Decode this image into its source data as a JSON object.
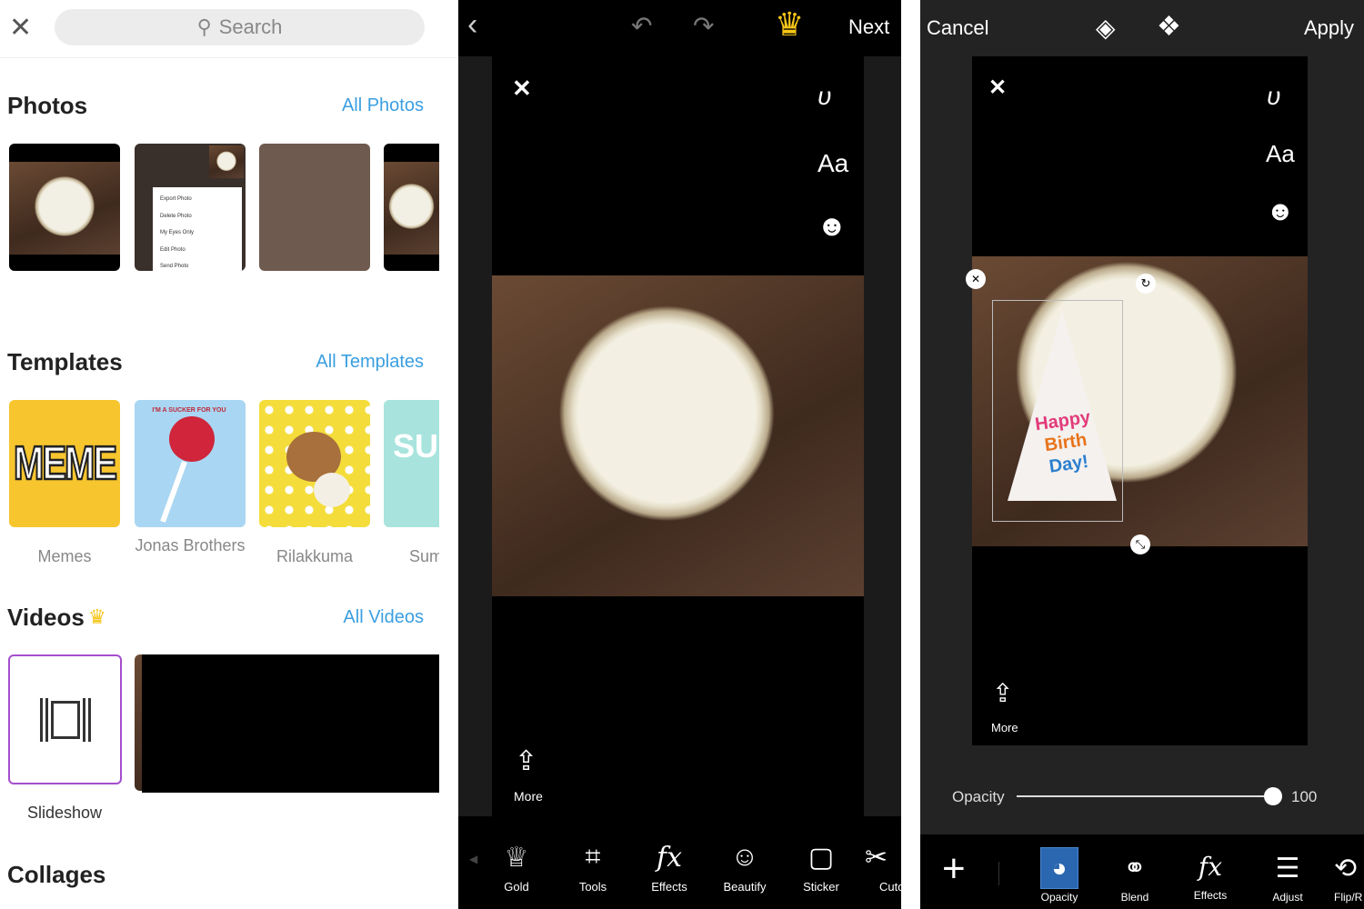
{
  "left": {
    "search_placeholder": "Search",
    "photos": {
      "title": "Photos",
      "link": "All Photos",
      "menu": [
        "Export Photo",
        "Delete Photo",
        "My Eyes Only",
        "Edit Photo",
        "Send Photo"
      ]
    },
    "templates": {
      "title": "Templates",
      "link": "All Templates",
      "items": [
        {
          "label": "Memes",
          "art": "MEME"
        },
        {
          "label": "Jonas Brothers",
          "art": "I'M A SUCKER FOR YOU"
        },
        {
          "label": "Rilakkuma"
        },
        {
          "label": "Sum",
          "art": "SUM"
        }
      ]
    },
    "videos": {
      "title": "Videos",
      "link": "All Videos",
      "slideshow": "Slideshow"
    },
    "collages": {
      "title": "Collages"
    }
  },
  "mid": {
    "next": "Next",
    "text_tool": "Aa",
    "more": "More",
    "tools": [
      "Gold",
      "Tools",
      "Effects",
      "Beautify",
      "Sticker",
      "Cuto"
    ],
    "gold_color": "#f5c518"
  },
  "right": {
    "cancel": "Cancel",
    "apply": "Apply",
    "text_tool": "Aa",
    "more": "More",
    "sticker_text": [
      "Happy",
      "Birth",
      "Day!"
    ],
    "opacity": {
      "label": "Opacity",
      "value": "100"
    },
    "tools": [
      "Opacity",
      "Blend",
      "Effects",
      "Adjust",
      "Flip/R"
    ],
    "active_tool": "Opacity",
    "active_color": "#2b67b0"
  }
}
